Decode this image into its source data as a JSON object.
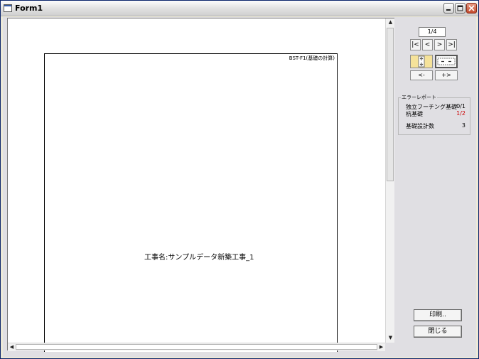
{
  "window": {
    "title": "Form1"
  },
  "preview": {
    "page_id": "BST-F1(基礎の計算)",
    "project_name": "工事名:サンプルデータ新築工事_1"
  },
  "navigation": {
    "page_counter": "1/4",
    "first_label": "|<",
    "prev_label": "<",
    "next_label": ">",
    "last_label": ">|",
    "zoom_out_label": "<-",
    "zoom_in_label": "+>"
  },
  "error_report": {
    "title": "エラーレポート",
    "rows": [
      {
        "label": "独立フーチング基礎",
        "value": "0/1",
        "color": "#000000"
      },
      {
        "label": "杭基礎",
        "value": "1/2",
        "color": "#cc0000"
      }
    ],
    "total_label": "基礎設計数",
    "total_value": "3"
  },
  "actions": {
    "print_label": "印刷..",
    "close_label": "閉じる"
  },
  "colors": {
    "error_red": "#cc0000",
    "view_active": "#f5e29a"
  }
}
